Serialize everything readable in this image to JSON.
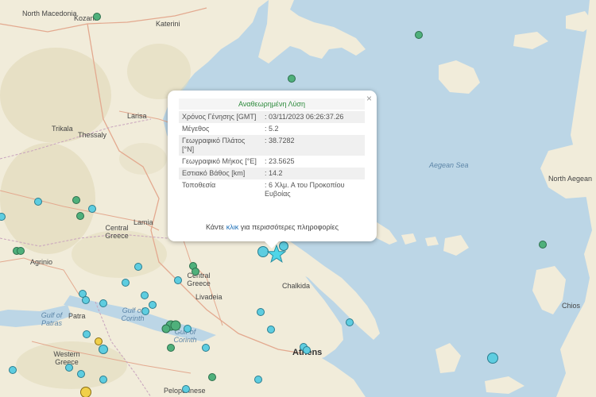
{
  "colors": {
    "sea": "#bcd6e6",
    "land": "#f1ecda",
    "terrain": "#e2dcbc",
    "green_quake": "#4fb07b",
    "cyan_quake": "#5ecde0",
    "star": "#4fd6e8"
  },
  "labels": {
    "north_macedonia": "North Macedonia",
    "kozani": "Kozani",
    "katerini": "Katerini",
    "trikala": "Trikala",
    "larisa": "Larisa",
    "thessaly": "Thessaly",
    "central_greece_1": "Central Greece",
    "central_greece_2": "Central Greece",
    "lamia": "Lamia",
    "agrinio": "Agrinio",
    "livadeia": "Livadeia",
    "chalkida": "Chalkida",
    "patra": "Patra",
    "gulf_patras": "Gulf of Patras",
    "gulf_corinth_1": "Gulf of Corinth",
    "gulf_corinth_2": "Gulf of Corinth",
    "western_greece": "Western Greece",
    "peloponnese": "Peloponnese",
    "athens": "Athens",
    "aegean_sea": "Aegean Sea",
    "north_aegean": "North Aegean",
    "chios": "Chios"
  },
  "popup": {
    "title": "Αναθεωρημένη Λύση",
    "close": "×",
    "rows": [
      {
        "key": "Χρόνος Γένησης [GMT]",
        "value": ": 03/11/2023 06:26:37.26"
      },
      {
        "key": "Μέγεθος",
        "value": ": 5.2"
      },
      {
        "key": "Γεωγραφικό Πλάτος [°N]",
        "value": ": 38.7282"
      },
      {
        "key": "Γεωγραφικό Μήκος [°E]",
        "value": ": 23.5625"
      },
      {
        "key": "Εστιακό Βάθος [km]",
        "value": ": 14.2"
      },
      {
        "key": "Τοποθεσία",
        "value": ": 6 Χλμ. Α του Προκοπίου Ευβοίας"
      }
    ],
    "more_prefix": "Κάντε",
    "more_link": "κλικ",
    "more_suffix": "για περισσότερες πληροφορίες"
  }
}
